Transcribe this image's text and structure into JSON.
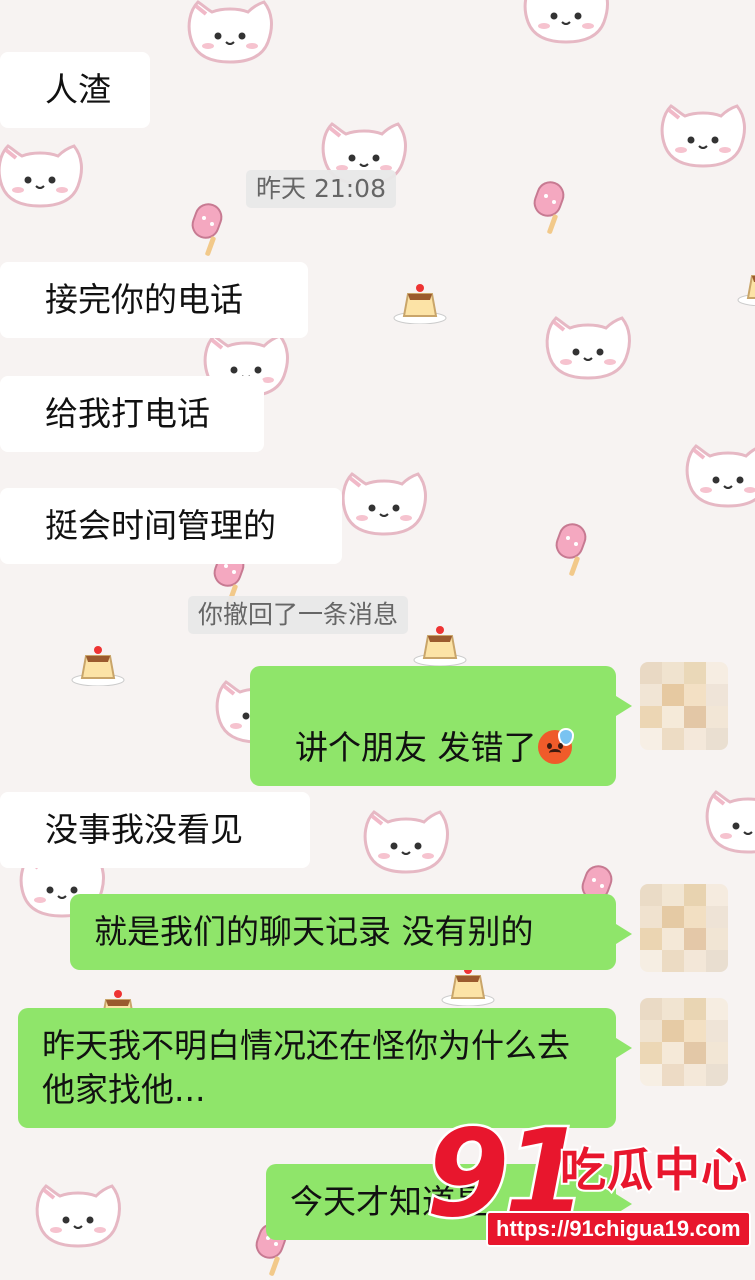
{
  "chat": {
    "messages": [
      {
        "side": "in",
        "text": "人渣"
      },
      {
        "side": "stamp",
        "text": "昨天 21:08"
      },
      {
        "side": "in",
        "text": "接完你的电话"
      },
      {
        "side": "in",
        "text": "给我打电话"
      },
      {
        "side": "in",
        "text": "挺会时间管理的"
      },
      {
        "side": "stamp",
        "text": "你撤回了一条消息"
      },
      {
        "side": "out",
        "text": "讲个朋友 发错了"
      },
      {
        "side": "in",
        "text": "没事我没看见"
      },
      {
        "side": "out",
        "text": "就是我们的聊天记录 没有别的"
      },
      {
        "side": "out",
        "text": "昨天我不明白情况还在怪你为什么去他家找他..."
      },
      {
        "side": "out",
        "text": "今天才知道是"
      }
    ],
    "emoji": "sad-sweat-face-icon"
  },
  "watermark": {
    "number": "91",
    "brand": "吃瓜中心",
    "url": "https://91chigua19.com"
  },
  "colors": {
    "background": "#f7f3f2",
    "outgoing_bubble": "#8fe56a",
    "incoming_bubble": "#ffffff",
    "watermark_red": "#e8162d"
  }
}
